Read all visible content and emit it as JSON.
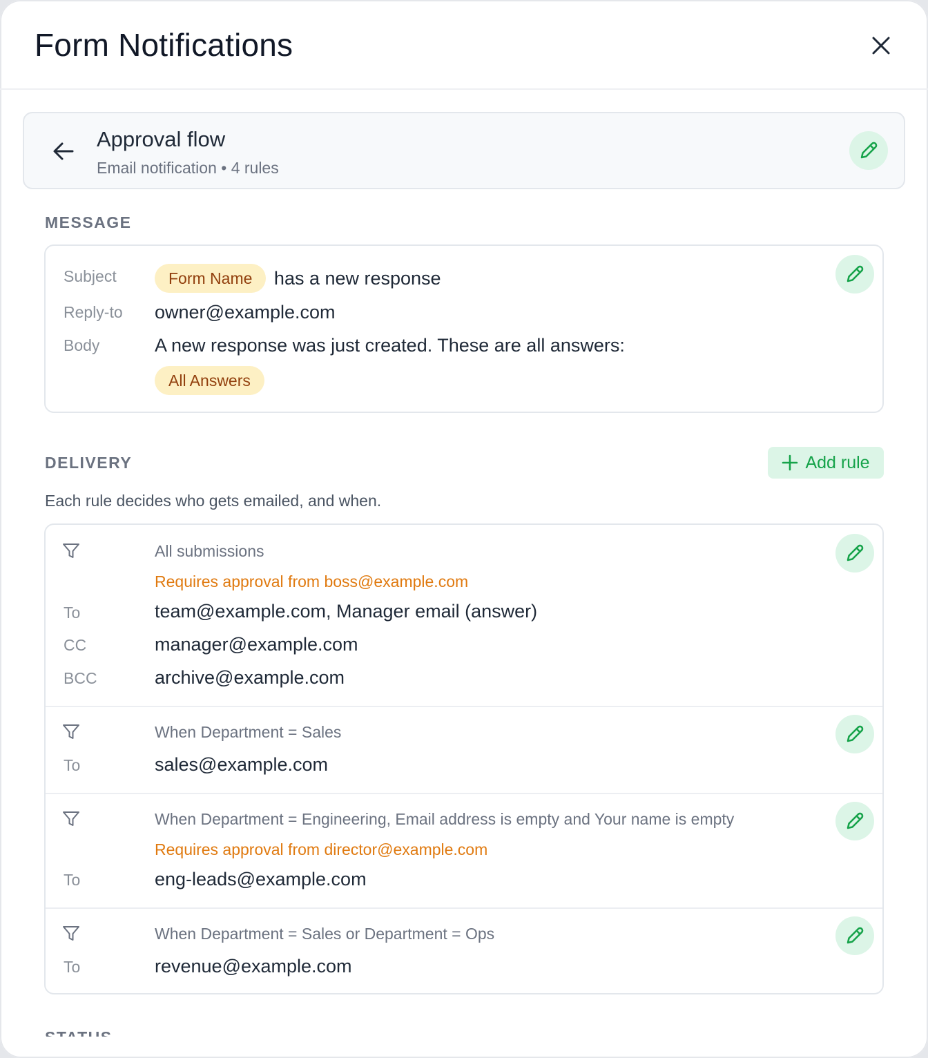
{
  "header": {
    "title": "Form Notifications"
  },
  "flow": {
    "title": "Approval flow",
    "subtitle": "Email notification • 4 rules"
  },
  "message": {
    "section_label": "MESSAGE",
    "subject_label": "Subject",
    "subject_chip": "Form Name",
    "subject_text": "has a new response",
    "reply_to_label": "Reply-to",
    "reply_to_value": "owner@example.com",
    "body_label": "Body",
    "body_text": "A new response was just created. These are all answers:",
    "body_chip": "All Answers"
  },
  "delivery": {
    "section_label": "DELIVERY",
    "add_rule_label": "Add rule",
    "helper": "Each rule decides who gets emailed, and when.",
    "rules": [
      {
        "condition": "All submissions",
        "approval": "Requires approval from boss@example.com",
        "to_label": "To",
        "to": "team@example.com, Manager email (answer)",
        "cc_label": "CC",
        "cc": "manager@example.com",
        "bcc_label": "BCC",
        "bcc": "archive@example.com"
      },
      {
        "condition": "When Department = Sales",
        "to_label": "To",
        "to": "sales@example.com"
      },
      {
        "condition": "When Department = Engineering, Email address is empty and Your name is empty",
        "approval": "Requires approval from director@example.com",
        "to_label": "To",
        "to": "eng-leads@example.com"
      },
      {
        "condition": "When Department = Sales or Department = Ops",
        "to_label": "To",
        "to": "revenue@example.com"
      }
    ]
  },
  "status": {
    "section_label": "STATUS"
  },
  "colors": {
    "accent": "#16a34a",
    "accent_bg": "#dcf5e7",
    "chip_bg": "#fdf0c4",
    "approval": "#e07a10"
  }
}
